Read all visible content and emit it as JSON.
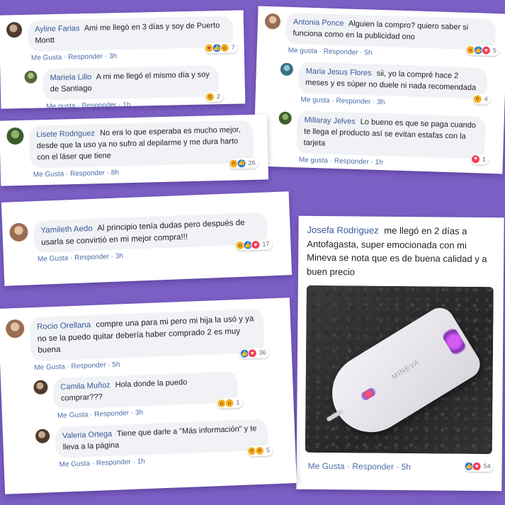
{
  "colors": {
    "background": "#7b5fc4",
    "name": "#385898",
    "link": "#4b6ea8"
  },
  "cards": {
    "c1": {
      "comment": {
        "name": "Ayline Farias",
        "text": "Ami me llegó en 3 días y soy de Puerto Montt",
        "reaction_count": "7",
        "actions": "Me Gusta · Responder · 3h"
      },
      "reply": {
        "name": "Mariela Lillo",
        "text": "A mi me llegó el mismo día y soy de Santiago",
        "reaction_count": "2",
        "actions": "Me gusta · Responder · 1h"
      }
    },
    "c2": {
      "comment": {
        "name": "Antonia Ponce",
        "text": "Alguien la compro? quiero saber si funciona como en la publicidad ono",
        "reaction_count": "5",
        "actions": "Me gusta · Responder · 5h"
      },
      "reply1": {
        "name": "Maria Jesus Flores",
        "text": "sii, yo la compré hace 2 meses y es súper no duele ni nada recomendada",
        "reaction_count": "4",
        "actions": "Me gusta · Responder · 3h"
      },
      "reply2": {
        "name": "Millaray Jelves",
        "text": "Lo bueno es que se paga cuando te llega el producto así se evitan estafas con la tarjeta",
        "reaction_count": "1",
        "actions": "Me gusta · Responder · 1h"
      }
    },
    "c3": {
      "comment": {
        "name": "Lisete Rodriguez",
        "text": "No era lo que esperaba es mucho mejor, desde que la uso ya no sufro al depilarme y me dura harto con el láser que tiene",
        "reaction_count": "26",
        "actions": "Me Gusta · Responder · 8h"
      }
    },
    "c4": {
      "comment": {
        "name": "Yamileth Aedo",
        "text": "Al principio tenía dudas pero después de usarla se convirtió en mi mejor compra!!!",
        "reaction_count": "17",
        "actions": "Me Gusta · Responder · 3h"
      }
    },
    "c5": {
      "comment": {
        "name": "Josefa Rodriguez",
        "text": "me llegó en 2 días a Antofagasta, super emocionada con mi Mineva se nota que es de buena calidad y a buen precio",
        "reaction_count": "54",
        "actions": "Me Gusta · Responder · 5h"
      },
      "device_label": "MINEVA"
    },
    "c6": {
      "comment": {
        "name": "Rocio Orellana",
        "text": "compre una para mi pero mi hija la usó y ya no se la puedo quitar debería haber comprado 2 es muy buena",
        "reaction_count": "36",
        "actions": "Me Gusta · Responder · 5h"
      },
      "reply1": {
        "name": "Camila Muñoz",
        "text": "Hola donde la puedo comprar???",
        "reaction_count": "1",
        "actions": "Me Gusta · Responder · 3h"
      },
      "reply2": {
        "name": "Valeria Ortega",
        "text": "Tiene que darle a \"Más información\" y te lleva a la página",
        "reaction_count": "5",
        "actions": "Me Gusta · Responder · 1h"
      }
    }
  }
}
